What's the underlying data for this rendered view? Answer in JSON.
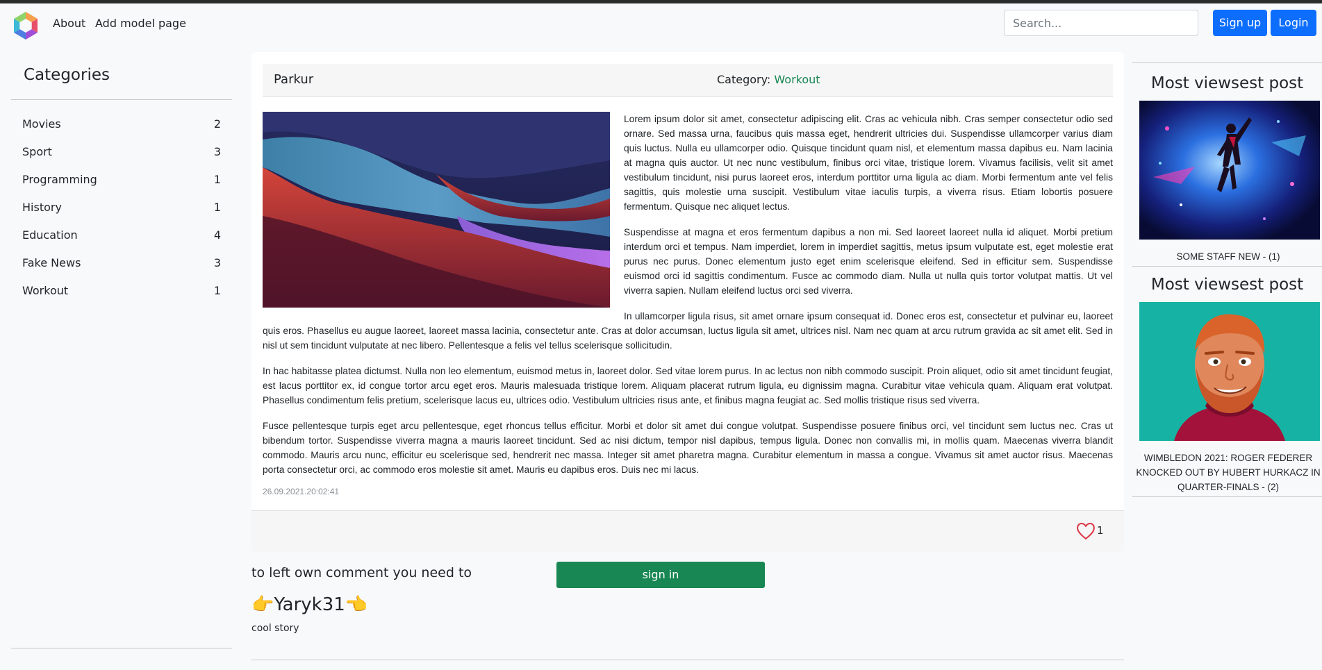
{
  "navbar": {
    "about_label": "About",
    "add_model_label": "Add model page",
    "search_placeholder": "Search...",
    "signup_label": "Sign up",
    "login_label": "Login"
  },
  "sidebar": {
    "title": "Categories",
    "items": [
      {
        "label": "Movies",
        "count": "2"
      },
      {
        "label": "Sport",
        "count": "3"
      },
      {
        "label": "Programming",
        "count": "1"
      },
      {
        "label": "History",
        "count": "1"
      },
      {
        "label": "Education",
        "count": "4"
      },
      {
        "label": "Fake News",
        "count": "3"
      },
      {
        "label": "Workout",
        "count": "1"
      }
    ]
  },
  "post": {
    "title": "Parkur",
    "category_prefix": "Category:",
    "category": "Workout",
    "paragraphs": [
      "Lorem ipsum dolor sit amet, consectetur adipiscing elit. Cras ac vehicula nibh. Cras semper consectetur odio sed ornare. Sed massa urna, faucibus quis massa eget, hendrerit ultricies dui. Suspendisse ullamcorper varius diam quis luctus. Nulla eu ullamcorper odio. Quisque tincidunt quam nisl, et elementum massa dapibus eu. Nam lacinia at magna quis auctor. Ut nec nunc vestibulum, finibus orci vitae, tristique lorem. Vivamus facilisis, velit sit amet vestibulum tincidunt, nisi purus laoreet eros, interdum porttitor urna ligula ac diam. Morbi fermentum ante vel felis sagittis, quis molestie urna suscipit. Vestibulum vitae iaculis turpis, a viverra risus. Etiam lobortis posuere fermentum. Quisque nec aliquet lectus.",
      "Suspendisse at magna et eros fermentum dapibus a non mi. Sed laoreet laoreet nulla id aliquet. Morbi pretium interdum orci et tempus. Nam imperdiet, lorem in imperdiet sagittis, metus ipsum vulputate est, eget molestie erat purus nec purus. Donec elementum justo eget enim scelerisque eleifend. Sed in efficitur sem. Suspendisse euismod orci id sagittis condimentum. Fusce ac commodo diam. Nulla ut nulla quis tortor volutpat mattis. Ut vel viverra sapien. Nullam eleifend luctus orci sed viverra.",
      "In ullamcorper ligula risus, sit amet ornare ipsum consequat id. Donec eros est, consectetur et pulvinar eu, laoreet quis eros. Phasellus eu augue laoreet, laoreet massa lacinia, consectetur ante. Cras at dolor accumsan, luctus ligula sit amet, ultrices nisl. Nam nec quam at arcu rutrum gravida ac sit amet elit. Sed in nisl ut sem tincidunt vulputate at nec libero. Pellentesque a felis vel tellus scelerisque sollicitudin.",
      "In hac habitasse platea dictumst. Nulla non leo elementum, euismod metus in, laoreet dolor. Sed vitae lorem purus. In ac lectus non nibh commodo suscipit. Proin aliquet, odio sit amet tincidunt feugiat, est lacus porttitor ex, id congue tortor arcu eget eros. Mauris malesuada tristique lorem. Aliquam placerat rutrum ligula, eu dignissim magna. Curabitur vitae vehicula quam. Aliquam erat volutpat. Phasellus condimentum felis pretium, scelerisque lacus eu, ultrices odio. Vestibulum ultricies risus ante, et finibus magna feugiat ac. Sed mollis tristique risus sed viverra.",
      "Fusce pellentesque turpis eget arcu pellentesque, eget rhoncus tellus efficitur. Morbi et dolor sit amet dui congue volutpat. Suspendisse posuere finibus orci, vel tincidunt sem luctus nec. Cras ut bibendum tortor. Suspendisse viverra magna a mauris laoreet tincidunt. Sed ac nisi dictum, tempor nisl dapibus, tempus ligula. Donec non convallis mi, in mollis quam. Maecenas viverra blandit commodo. Mauris arcu nunc, efficitur eu scelerisque sed, hendrerit nec massa. Integer sit amet pharetra magna. Curabitur elementum in massa a congue. Vivamus sit amet auctor risus. Maecenas porta consectetur orci, ac commodo eros molestie sit amet. Mauris eu dapibus eros. Duis nec mi lacus."
    ],
    "date": "26.09.2021.20:02:41",
    "like_count": "1"
  },
  "comments": {
    "prompt": "to left own comment you need to",
    "signin_label": "sign in",
    "author": "👉Yaryk31👈",
    "text": "cool story"
  },
  "right": {
    "posts": [
      {
        "heading": "Most viewsest post",
        "caption": "SOME STAFF NEW - (1)"
      },
      {
        "heading": "Most viewsest post",
        "caption": "WIMBLEDON 2021: ROGER FEDERER KNOCKED OUT BY HUBERT HURKACZ IN QUARTER-FINALS - (2)"
      }
    ]
  },
  "colors": {
    "primary": "#0d6efd",
    "success": "#198754",
    "like": "#dc3545"
  }
}
